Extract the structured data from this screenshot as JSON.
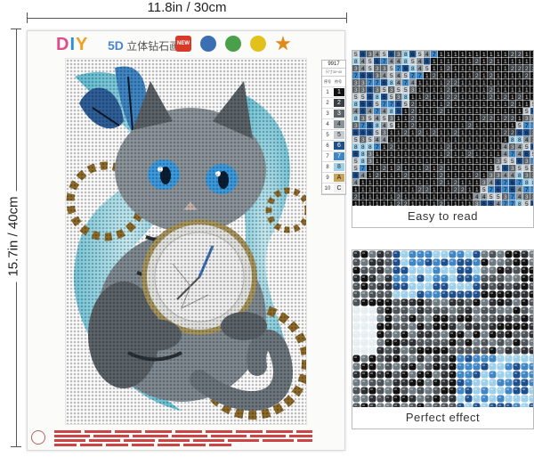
{
  "dimensions": {
    "width_label": "11.8in / 30cm",
    "height_label": "15.7in / 40cm"
  },
  "card": {
    "brand_letters": [
      "D",
      "I",
      "Y"
    ],
    "brand_5d": "5D",
    "brand_cn": "立体钻石画",
    "badges": [
      {
        "name": "new",
        "text": "NEW",
        "color": "#d83a2a"
      },
      {
        "name": "shield",
        "text": "",
        "color": "#3b6fb3"
      },
      {
        "name": "recycle",
        "text": "",
        "color": "#4aa04a"
      },
      {
        "name": "sun",
        "text": "",
        "color": "#e2c21a"
      },
      {
        "name": "star",
        "text": "",
        "color": "#e08a1a"
      }
    ],
    "legend": {
      "code": "9917",
      "size": "尺寸30*40",
      "header_no": "序号",
      "header_sym": "符号",
      "rows": [
        {
          "n": "1",
          "sym": "1",
          "color": "#111111"
        },
        {
          "n": "2",
          "sym": "2",
          "color": "#3a3f44"
        },
        {
          "n": "3",
          "sym": "3",
          "color": "#5b6368"
        },
        {
          "n": "4",
          "sym": "4",
          "color": "#8a949a"
        },
        {
          "n": "5",
          "sym": "5",
          "color": "#c5cbcf"
        },
        {
          "n": "6",
          "sym": "6",
          "color": "#1c4f8c"
        },
        {
          "n": "7",
          "sym": "7",
          "color": "#3f86c4"
        },
        {
          "n": "8",
          "sym": "8",
          "color": "#9fd0ea"
        },
        {
          "n": "9",
          "sym": "A",
          "color": "#c9a45a"
        },
        {
          "n": "10",
          "sym": "C",
          "color": "#f1f1f1"
        }
      ]
    }
  },
  "panels": [
    {
      "caption": "Easy to read"
    },
    {
      "caption": "Perfect effect"
    }
  ],
  "colors": {
    "teal": "#7ed0e0",
    "cat_gray": "#7f8a92",
    "gear_gold": "#8c6a2a",
    "eye_blue": "#3b9be0"
  }
}
